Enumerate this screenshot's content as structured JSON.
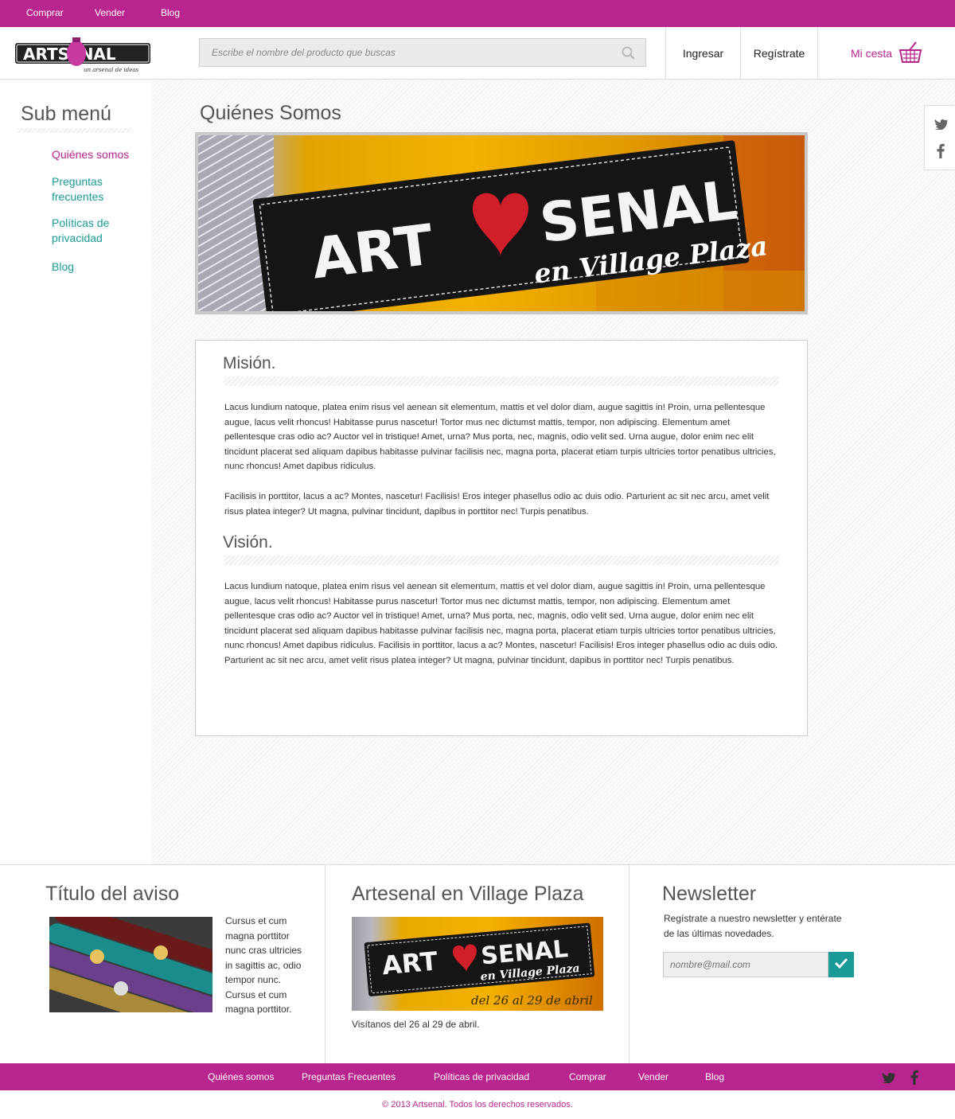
{
  "top_nav": {
    "items": [
      "Comprar",
      "Vender",
      "Blog"
    ]
  },
  "header": {
    "logo_text": "ARTSENAL",
    "logo_tagline": "un arsenal de ideas",
    "search_placeholder": "Escribe el nombre del producto que buscas",
    "login_label": "Ingresar",
    "register_label": "Regístrate",
    "cart_label": "Mi cesta"
  },
  "sidebar": {
    "title": "Sub menú",
    "items": [
      {
        "label": "Quiénes somos",
        "active": true
      },
      {
        "label": "Preguntas frecuentes",
        "active": false
      },
      {
        "label": "Políticas de privacidad",
        "active": false
      },
      {
        "label": "Blog",
        "active": false
      }
    ]
  },
  "main": {
    "title": "Quiénes Somos",
    "banner": {
      "line1_left": "ART",
      "line1_right": "SENAL",
      "line2": "en Village Plaza"
    },
    "mission": {
      "title": "Misión.",
      "paragraphs": [
        "Lacus lundium natoque, platea enim risus vel aenean sit elementum, mattis et vel dolor diam, augue sagittis in! Proin, urna pellentesque augue, lacus velit rhoncus! Habitasse purus nascetur! Tortor mus nec dictumst mattis, tempor, non adipiscing. Elementum amet pellentesque cras odio ac? Auctor vel in tristique! Amet, urna? Mus porta, nec, magnis, odio velit sed. Urna augue, dolor enim nec elit tincidunt placerat sed aliquam dapibus habitasse pulvinar facilisis nec, magna porta, placerat etiam turpis ultricies tortor penatibus ultricies, nunc rhoncus! Amet dapibus ridiculus.",
        "Facilisis in porttitor, lacus a ac? Montes, nascetur! Facilisis! Eros integer phasellus odio ac duis odio. Parturient ac sit nec arcu, amet velit risus platea integer? Ut magna, pulvinar tincidunt, dapibus in porttitor nec! Turpis penatibus."
      ]
    },
    "vision": {
      "title": "Visión.",
      "paragraphs": [
        "Lacus lundium natoque, platea enim risus vel aenean sit elementum, mattis et vel dolor diam, augue sagittis in! Proin, urna pellentesque augue, lacus velit rhoncus! Habitasse purus nascetur! Tortor mus nec dictumst mattis, tempor, non adipiscing. Elementum amet pellentesque cras odio ac? Auctor vel in tristique! Amet, urna? Mus porta, nec, magnis, odio velit sed. Urna augue, dolor enim nec elit tincidunt placerat sed aliquam dapibus habitasse pulvinar facilisis nec, magna porta, placerat etiam turpis ultricies tortor penatibus ultricies, nunc rhoncus! Amet dapibus ridiculus. Facilisis in porttitor, lacus a ac? Montes, nascetur! Facilisis! Eros integer phasellus odio ac duis odio. Parturient ac sit nec arcu, amet velit risus platea integer? Ut magna, pulvinar tincidunt, dapibus in porttitor nec! Turpis penatibus."
      ]
    }
  },
  "footer": {
    "notice": {
      "title": "Título del aviso",
      "text": "Cursus et cum magna porttitor nunc cras ultricies in sagittis ac, odio tempor nunc. Cursus et cum magna porttitor."
    },
    "event": {
      "title": "Artesenal en Village Plaza",
      "banner_line1_left": "ART",
      "banner_line1_right": "SENAL",
      "banner_line2": "en Village Plaza",
      "banner_dates": "del 26 al 29 de abril",
      "caption": "Visítanos del 26 al 29 de abril."
    },
    "newsletter": {
      "title": "Newsletter",
      "text": "Regístrate a nuestro newsletter y entérate de las últimas novedades.",
      "placeholder": "nombre@mail.com"
    }
  },
  "bottom_nav": {
    "items": [
      "Quiénes somos",
      "Preguntas Frecuentes",
      "Políticas de privacidad",
      "Comprar",
      "Vender",
      "Blog"
    ]
  },
  "copyright": "© 2013 Artsenal. Todos los derechos reservados.",
  "colors": {
    "brand": "#b8258f",
    "accent": "#1a9a97"
  },
  "icons": [
    "search-icon",
    "cart-icon",
    "twitter-icon",
    "facebook-icon",
    "check-icon"
  ]
}
